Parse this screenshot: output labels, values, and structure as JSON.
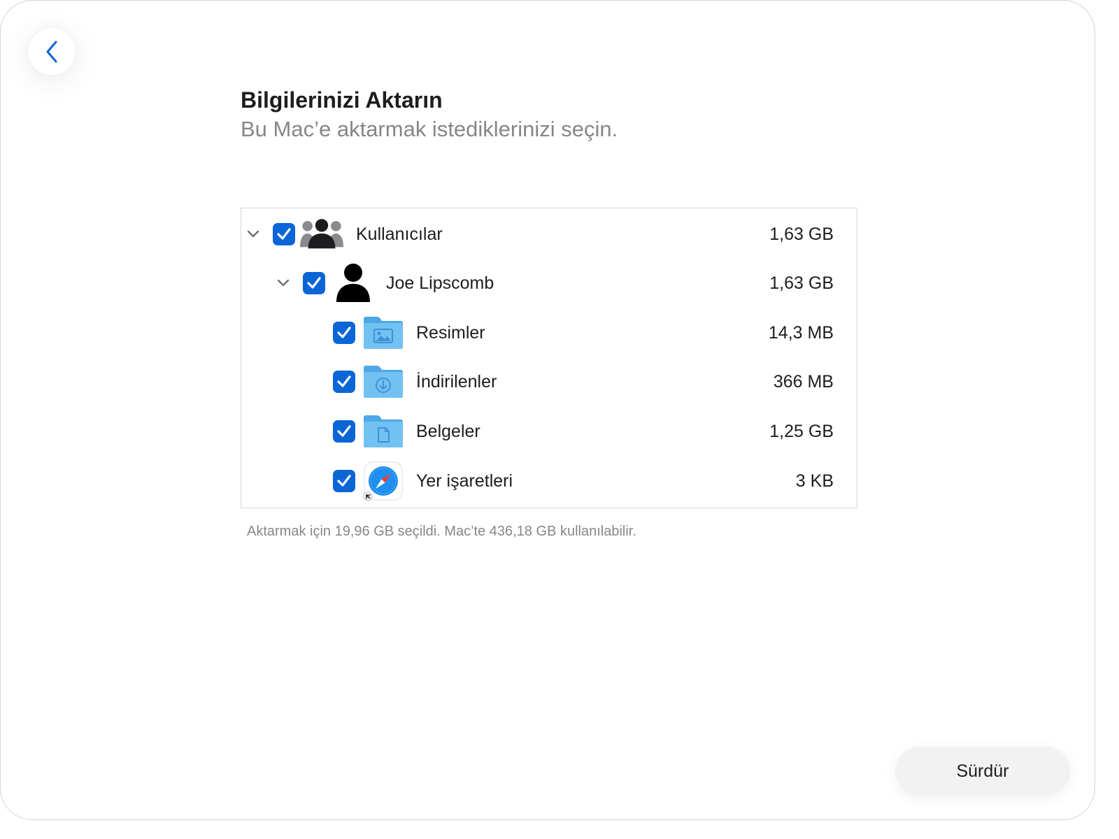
{
  "header": {
    "title": "Bilgilerinizi Aktarın",
    "subtitle": "Bu Mac’e aktarmak istediklerinizi seçin."
  },
  "items": [
    {
      "label": "Kullanıcılar",
      "size": "1,63 GB",
      "checked": true,
      "icon": "users-group-icon"
    },
    {
      "label": "Joe Lipscomb",
      "size": "1,63 GB",
      "checked": true,
      "icon": "user-silhouette-icon"
    },
    {
      "label": "Resimler",
      "size": "14,3 MB",
      "checked": true,
      "icon": "pictures-folder-icon"
    },
    {
      "label": "İndirilenler",
      "size": "366 MB",
      "checked": true,
      "icon": "downloads-folder-icon"
    },
    {
      "label": "Belgeler",
      "size": "1,25 GB",
      "checked": true,
      "icon": "documents-folder-icon"
    },
    {
      "label": "Yer işaretleri",
      "size": "3 KB",
      "checked": true,
      "icon": "safari-bookmarks-icon"
    }
  ],
  "footer": {
    "note": "Aktarmak için 19,96 GB seçildi. Mac’te 436,18 GB kullanılabilir.",
    "continue_label": "Sürdür"
  },
  "colors": {
    "accent": "#0a66d7",
    "folder": "#5fb4ee"
  }
}
